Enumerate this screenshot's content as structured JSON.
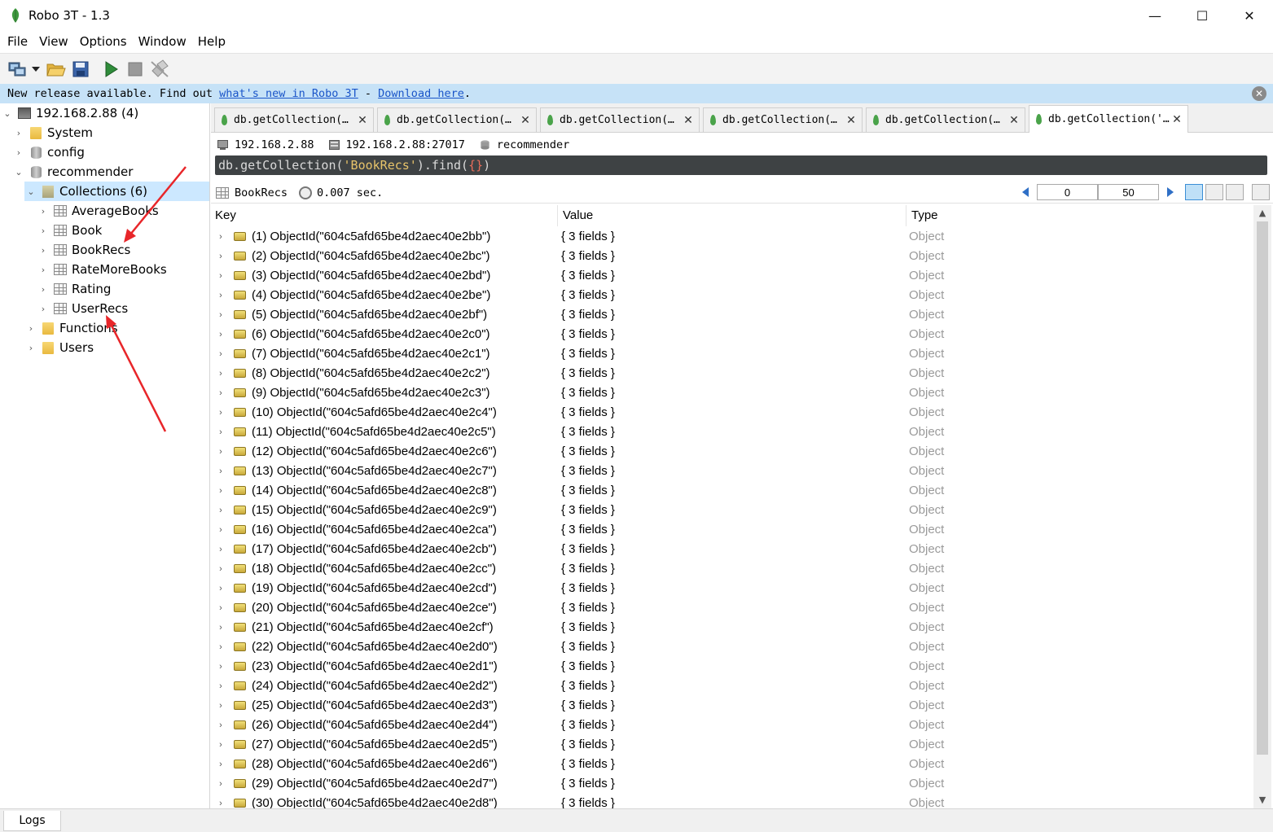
{
  "window": {
    "title": "Robo 3T - 1.3",
    "minimize_glyph": "—",
    "maximize_glyph": "☐",
    "close_glyph": "✕"
  },
  "menu": [
    "File",
    "View",
    "Options",
    "Window",
    "Help"
  ],
  "banner": {
    "text_before": "New release available. Find out ",
    "link1": "what's new in Robo 3T",
    "text_mid": " - ",
    "link2": "Download here",
    "text_after": ".",
    "close_glyph": "✕"
  },
  "tree": {
    "server": "192.168.2.88 (4)",
    "system": "System",
    "config": "config",
    "database": "recommender",
    "collections_folder": "Collections (6)",
    "collections": [
      "AverageBooks",
      "Book",
      "BookRecs",
      "RateMoreBooks",
      "Rating",
      "UserRecs"
    ],
    "functions": "Functions",
    "users": "Users"
  },
  "tabs": [
    {
      "label": "db.getCollection(…",
      "active": false
    },
    {
      "label": "db.getCollection(…",
      "active": false
    },
    {
      "label": "db.getCollection(…",
      "active": false
    },
    {
      "label": "db.getCollection(…",
      "active": false
    },
    {
      "label": "db.getCollection(…",
      "active": false
    },
    {
      "label": "db.getCollection('…",
      "active": true
    }
  ],
  "tab_close_glyph": "✕",
  "conn": {
    "host": "192.168.2.88",
    "host_port": "192.168.2.88:27017",
    "database": "recommender"
  },
  "query": {
    "prefix": "db.getCollection(",
    "collection": "'BookRecs'",
    "mid": ").find(",
    "braces": "{}",
    "suffix": ")"
  },
  "results": {
    "collection": "BookRecs",
    "time": "0.007 sec.",
    "skip": "0",
    "limit": "50"
  },
  "grid": {
    "headers": {
      "key": "Key",
      "value": "Value",
      "type": "Type"
    },
    "rows": [
      {
        "key": "(1) ObjectId(\"604c5afd65be4d2aec40e2bb\")",
        "value": "{ 3 fields }",
        "type": "Object"
      },
      {
        "key": "(2) ObjectId(\"604c5afd65be4d2aec40e2bc\")",
        "value": "{ 3 fields }",
        "type": "Object"
      },
      {
        "key": "(3) ObjectId(\"604c5afd65be4d2aec40e2bd\")",
        "value": "{ 3 fields }",
        "type": "Object"
      },
      {
        "key": "(4) ObjectId(\"604c5afd65be4d2aec40e2be\")",
        "value": "{ 3 fields }",
        "type": "Object"
      },
      {
        "key": "(5) ObjectId(\"604c5afd65be4d2aec40e2bf\")",
        "value": "{ 3 fields }",
        "type": "Object"
      },
      {
        "key": "(6) ObjectId(\"604c5afd65be4d2aec40e2c0\")",
        "value": "{ 3 fields }",
        "type": "Object"
      },
      {
        "key": "(7) ObjectId(\"604c5afd65be4d2aec40e2c1\")",
        "value": "{ 3 fields }",
        "type": "Object"
      },
      {
        "key": "(8) ObjectId(\"604c5afd65be4d2aec40e2c2\")",
        "value": "{ 3 fields }",
        "type": "Object"
      },
      {
        "key": "(9) ObjectId(\"604c5afd65be4d2aec40e2c3\")",
        "value": "{ 3 fields }",
        "type": "Object"
      },
      {
        "key": "(10) ObjectId(\"604c5afd65be4d2aec40e2c4\")",
        "value": "{ 3 fields }",
        "type": "Object"
      },
      {
        "key": "(11) ObjectId(\"604c5afd65be4d2aec40e2c5\")",
        "value": "{ 3 fields }",
        "type": "Object"
      },
      {
        "key": "(12) ObjectId(\"604c5afd65be4d2aec40e2c6\")",
        "value": "{ 3 fields }",
        "type": "Object"
      },
      {
        "key": "(13) ObjectId(\"604c5afd65be4d2aec40e2c7\")",
        "value": "{ 3 fields }",
        "type": "Object"
      },
      {
        "key": "(14) ObjectId(\"604c5afd65be4d2aec40e2c8\")",
        "value": "{ 3 fields }",
        "type": "Object"
      },
      {
        "key": "(15) ObjectId(\"604c5afd65be4d2aec40e2c9\")",
        "value": "{ 3 fields }",
        "type": "Object"
      },
      {
        "key": "(16) ObjectId(\"604c5afd65be4d2aec40e2ca\")",
        "value": "{ 3 fields }",
        "type": "Object"
      },
      {
        "key": "(17) ObjectId(\"604c5afd65be4d2aec40e2cb\")",
        "value": "{ 3 fields }",
        "type": "Object"
      },
      {
        "key": "(18) ObjectId(\"604c5afd65be4d2aec40e2cc\")",
        "value": "{ 3 fields }",
        "type": "Object"
      },
      {
        "key": "(19) ObjectId(\"604c5afd65be4d2aec40e2cd\")",
        "value": "{ 3 fields }",
        "type": "Object"
      },
      {
        "key": "(20) ObjectId(\"604c5afd65be4d2aec40e2ce\")",
        "value": "{ 3 fields }",
        "type": "Object"
      },
      {
        "key": "(21) ObjectId(\"604c5afd65be4d2aec40e2cf\")",
        "value": "{ 3 fields }",
        "type": "Object"
      },
      {
        "key": "(22) ObjectId(\"604c5afd65be4d2aec40e2d0\")",
        "value": "{ 3 fields }",
        "type": "Object"
      },
      {
        "key": "(23) ObjectId(\"604c5afd65be4d2aec40e2d1\")",
        "value": "{ 3 fields }",
        "type": "Object"
      },
      {
        "key": "(24) ObjectId(\"604c5afd65be4d2aec40e2d2\")",
        "value": "{ 3 fields }",
        "type": "Object"
      },
      {
        "key": "(25) ObjectId(\"604c5afd65be4d2aec40e2d3\")",
        "value": "{ 3 fields }",
        "type": "Object"
      },
      {
        "key": "(26) ObjectId(\"604c5afd65be4d2aec40e2d4\")",
        "value": "{ 3 fields }",
        "type": "Object"
      },
      {
        "key": "(27) ObjectId(\"604c5afd65be4d2aec40e2d5\")",
        "value": "{ 3 fields }",
        "type": "Object"
      },
      {
        "key": "(28) ObjectId(\"604c5afd65be4d2aec40e2d6\")",
        "value": "{ 3 fields }",
        "type": "Object"
      },
      {
        "key": "(29) ObjectId(\"604c5afd65be4d2aec40e2d7\")",
        "value": "{ 3 fields }",
        "type": "Object"
      },
      {
        "key": "(30) ObjectId(\"604c5afd65be4d2aec40e2d8\")",
        "value": "{ 3 fields }",
        "type": "Object"
      }
    ]
  },
  "statusbar": {
    "logs": "Logs"
  },
  "colors": {
    "banner_bg": "#c6e2f7",
    "link": "#1a55c9",
    "selection": "#cce8ff",
    "query_bg": "#3e4244",
    "annotation_arrow": "#e8262a"
  },
  "icons": {
    "app": "robo3t-leaf-icon",
    "toolbar": [
      "connect-icon",
      "dropdown-icon",
      "open-icon",
      "save-icon",
      "execute-icon",
      "stop-icon",
      "disconnect-icon"
    ]
  }
}
